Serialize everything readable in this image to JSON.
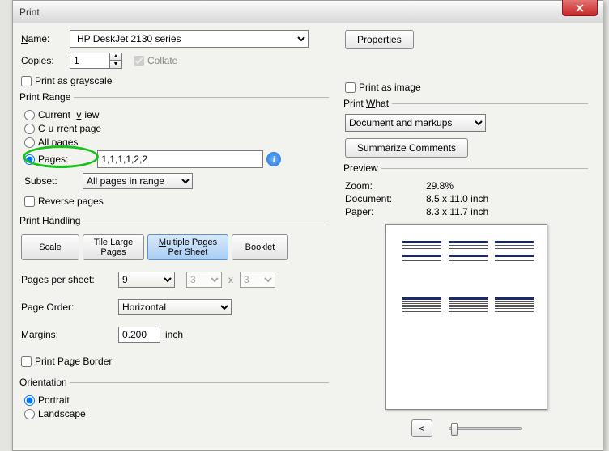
{
  "title": "Print",
  "name_label": "Name:",
  "printer": "HP DeskJet 2130 series",
  "properties_btn": "Properties",
  "copies_label": "Copies:",
  "copies_value": "1",
  "collate_label": "Collate",
  "grayscale_label": "Print as grayscale",
  "print_image_label": "Print as image",
  "print_range": {
    "legend": "Print Range",
    "current_view": "Current view",
    "current_page": "Current page",
    "all_pages": "All pages",
    "pages_label": "Pages:",
    "pages_value": "1,1,1,1,2,2",
    "subset_label": "Subset:",
    "subset_value": "All pages in range",
    "reverse": "Reverse pages"
  },
  "print_handling": {
    "legend": "Print Handling",
    "scale": "Scale",
    "tile": "Tile Large\nPages",
    "multi": "Multiple Pages\nPer Sheet",
    "booklet": "Booklet",
    "pps_label": "Pages per sheet:",
    "pps_value": "9",
    "pps_cols": "3",
    "pps_rows": "3",
    "order_label": "Page Order:",
    "order_value": "Horizontal",
    "margins_label": "Margins:",
    "margins_value": "0.200",
    "margins_unit": "inch",
    "border_label": "Print Page Border"
  },
  "orientation": {
    "legend": "Orientation",
    "portrait": "Portrait",
    "landscape": "Landscape"
  },
  "print_what": {
    "legend": "Print What",
    "value": "Document and markups",
    "summarize": "Summarize Comments"
  },
  "preview": {
    "legend": "Preview",
    "zoom_label": "Zoom:",
    "zoom_value": "29.8%",
    "doc_label": "Document:",
    "doc_value": "8.5 x 11.0 inch",
    "paper_label": "Paper:",
    "paper_value": "8.3 x 11.7 inch",
    "prev": "<",
    "next": ">"
  },
  "underlines": {
    "N": "N",
    "ame": "ame:",
    "C": "C",
    "opies": "opies:",
    "P": "P",
    "roperties": "roperties",
    "v": "v",
    "Current_": "Current ",
    "iew": "iew",
    "u": "u",
    "C2": "C",
    "rrent_page": "rrent page",
    "W": "W",
    "Print_": "Print ",
    "hat": "hat",
    "S": "S",
    "cale": "cale",
    "M": "M",
    "ultiple": "ultiple Pages",
    "B": "B",
    "ooklet": "ooklet"
  }
}
